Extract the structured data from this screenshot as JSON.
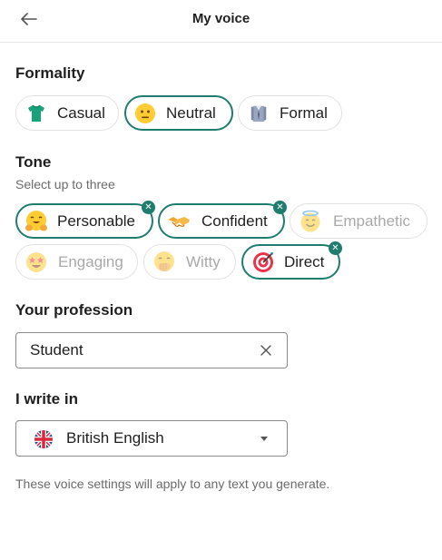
{
  "header": {
    "title": "My voice",
    "back_icon": "arrow-left-icon"
  },
  "formality": {
    "title": "Formality",
    "options": [
      {
        "label": "Casual",
        "icon": "tshirt-icon",
        "selected": false
      },
      {
        "label": "Neutral",
        "icon": "neutral-face-icon",
        "selected": true
      },
      {
        "label": "Formal",
        "icon": "suit-icon",
        "selected": false
      }
    ]
  },
  "tone": {
    "title": "Tone",
    "subtitle": "Select up to three",
    "options": [
      {
        "label": "Personable",
        "icon": "hugging-face-icon",
        "selected": true,
        "disabled": false
      },
      {
        "label": "Confident",
        "icon": "handshake-icon",
        "selected": true,
        "disabled": false
      },
      {
        "label": "Empathetic",
        "icon": "smiling-halo-icon",
        "selected": false,
        "disabled": true
      },
      {
        "label": "Engaging",
        "icon": "star-struck-icon",
        "selected": false,
        "disabled": true
      },
      {
        "label": "Witty",
        "icon": "face-hand-over-mouth-icon",
        "selected": false,
        "disabled": true
      },
      {
        "label": "Direct",
        "icon": "direct-hit-icon",
        "selected": true,
        "disabled": false
      }
    ]
  },
  "profession": {
    "title": "Your profession",
    "value": "Student",
    "clear_icon": "close-icon"
  },
  "language": {
    "title": "I write in",
    "value": "British English",
    "flag_icon": "uk-flag-icon",
    "caret_icon": "caret-down-icon"
  },
  "footnote": "These voice settings will apply to any text you generate.",
  "colors": {
    "accent": "#1f7d6e",
    "border": "#e2e2e2",
    "muted_text": "#a9a9a9"
  }
}
